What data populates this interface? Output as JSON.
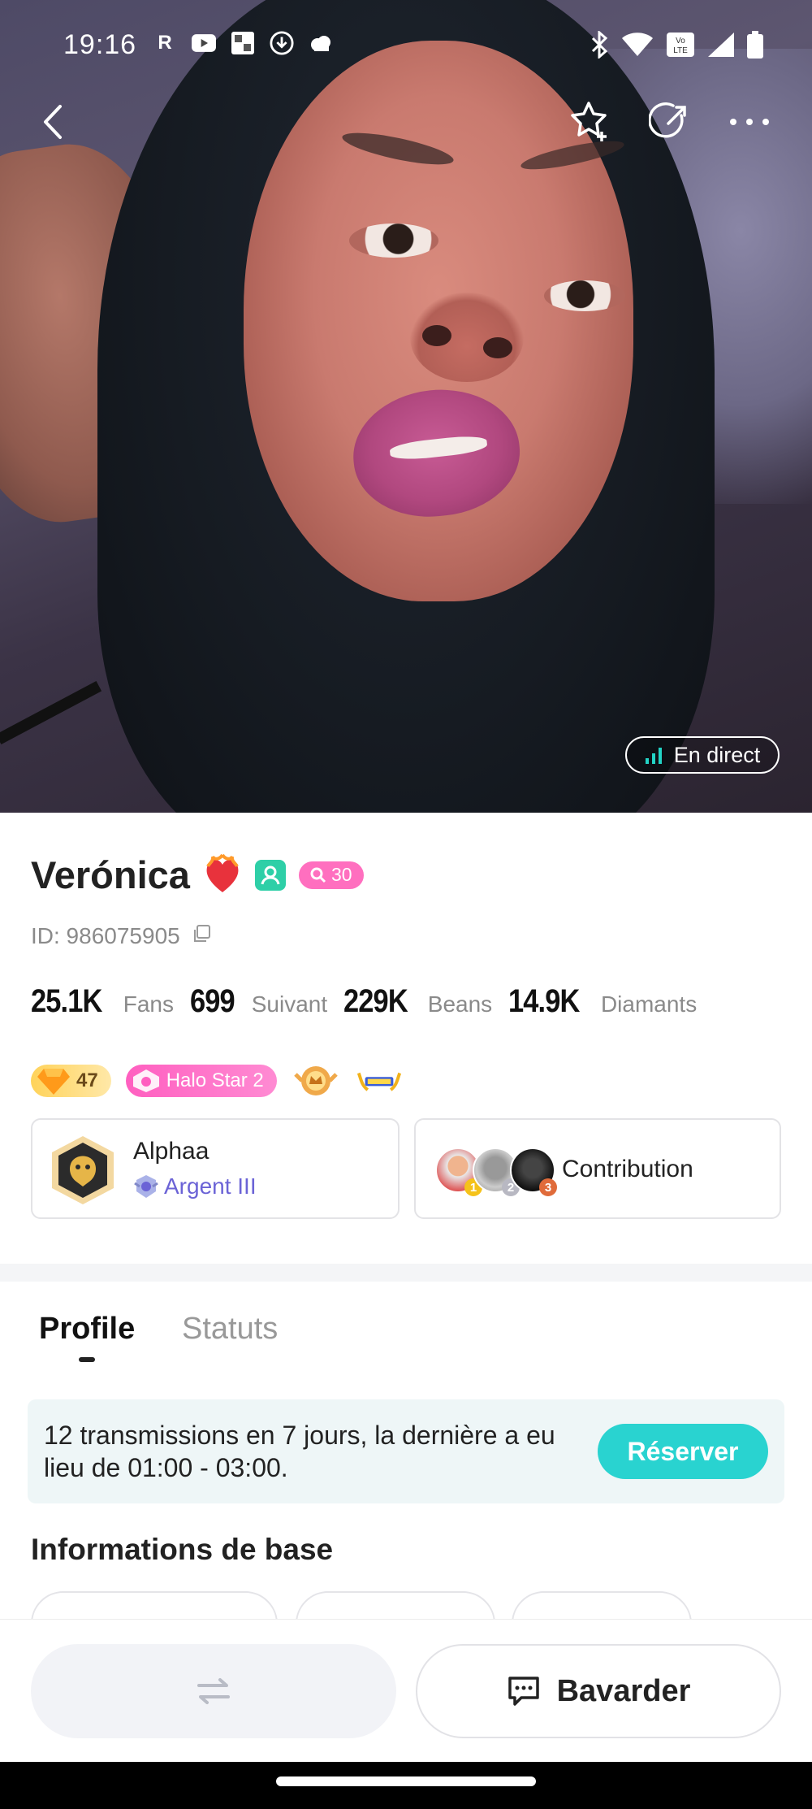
{
  "status_bar": {
    "time": "19:16",
    "left_icons": [
      "r-app-icon",
      "youtube-icon",
      "uniqlo-icon",
      "download-icon",
      "cloud-icon"
    ],
    "right_icons": [
      "bluetooth-icon",
      "wifi-icon",
      "volte-icon",
      "signal-icon",
      "battery-icon"
    ]
  },
  "hero": {
    "live_label": "En direct",
    "accent_live": "#22d3c5"
  },
  "profile": {
    "name": "Verónica",
    "level_badge": "30",
    "id_text": "ID: 986075905",
    "stats": [
      {
        "value": "25.1K",
        "label": "Fans"
      },
      {
        "value": "699",
        "label": "Suivant"
      },
      {
        "value": "229K",
        "label": "Beans"
      },
      {
        "value": "14.9K",
        "label": "Diamants"
      }
    ],
    "badges": {
      "diamond_level": "47",
      "halo": "Halo Star 2"
    }
  },
  "family_card": {
    "name": "Alphaa",
    "rank": "Argent III"
  },
  "contribution_card": {
    "label": "Contribution",
    "ranks": [
      "1",
      "2",
      "3"
    ]
  },
  "tabs": [
    {
      "label": "Profile",
      "active": true
    },
    {
      "label": "Statuts",
      "active": false
    }
  ],
  "schedule": {
    "text": "12 transmissions en 7 jours, la dernière a eu lieu de 01:00 - 03:00.",
    "button": "Réserver"
  },
  "section": {
    "title": "Informations de base"
  },
  "bottom_bar": {
    "chat_label": "Bavarder"
  }
}
